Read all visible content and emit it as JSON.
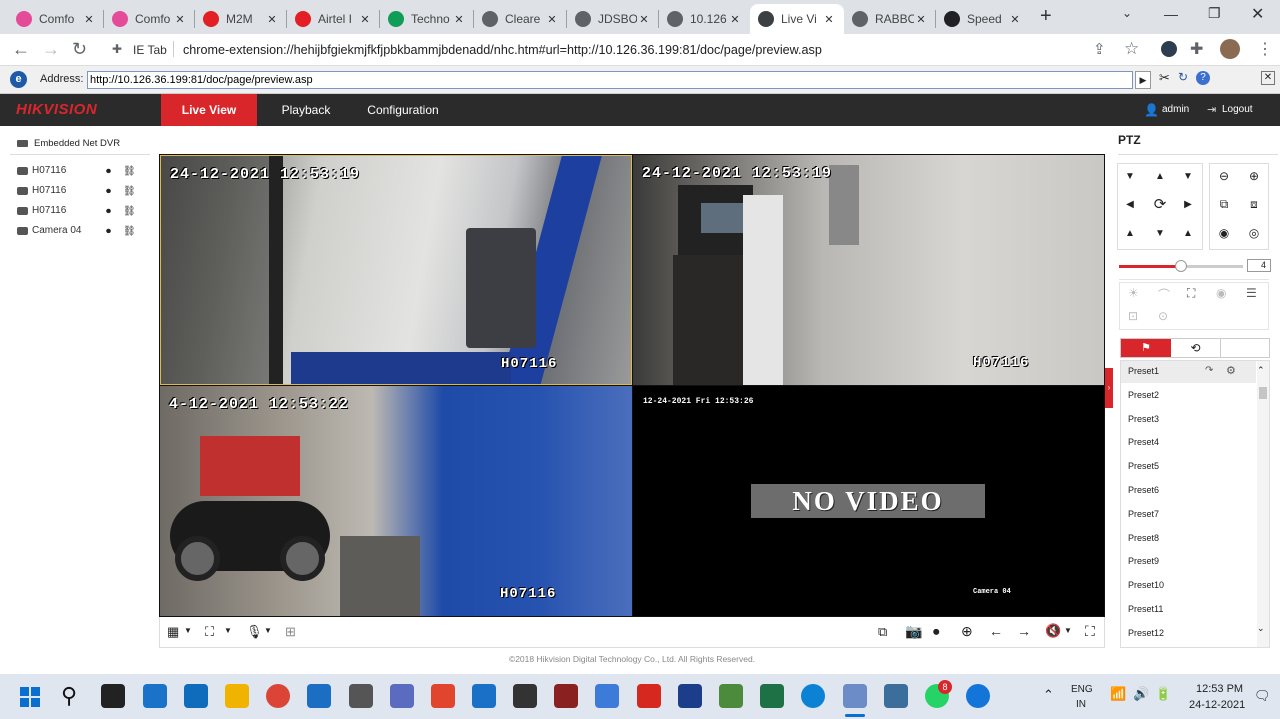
{
  "tabs": [
    {
      "title": "Comfo",
      "color": "#e44c9a"
    },
    {
      "title": "Comfo",
      "color": "#e44c9a"
    },
    {
      "title": "M2M",
      "color": "#e31e24"
    },
    {
      "title": "Airtel I",
      "color": "#e31e24"
    },
    {
      "title": "Techno",
      "color": "#0f9d58"
    },
    {
      "title": "Cleare",
      "color": "#5f6368"
    },
    {
      "title": "JDSBO",
      "color": "#5f6368"
    },
    {
      "title": "10.126",
      "color": "#5f6368"
    },
    {
      "title": "Live Vi",
      "color": "#3c4043",
      "active": true
    },
    {
      "title": "RABBO",
      "color": "#5f6368"
    },
    {
      "title": "Speed",
      "color": "#202124"
    }
  ],
  "toolbar": {
    "ext_label": "IE Tab",
    "url": "chrome-extension://hehijbfgiekmjfkfjpbkbammjbdenadd/nhc.htm#url=http://10.126.36.199:81/doc/page/preview.asp"
  },
  "ietab": {
    "address_label": "Address:",
    "address_value": "http://10.126.36.199:81/doc/page/preview.asp"
  },
  "hik": {
    "logo": "HIKVISION",
    "nav": [
      "Live View",
      "Playback",
      "Configuration"
    ],
    "user": "admin",
    "logout": "Logout"
  },
  "left_panel": {
    "device": "Embedded Net DVR",
    "cameras": [
      "H07116",
      "H07116",
      "H07116",
      "Camera 04"
    ]
  },
  "videos": [
    {
      "timestamp": "24-12-2021 12:53:19",
      "label": "H07116"
    },
    {
      "timestamp": "24-12-2021 12:53:19",
      "label": "H07116"
    },
    {
      "timestamp": "4-12-2021 12:53:22",
      "label": "H07116"
    },
    {
      "timestamp": "12-24-2021 Fri 12:53:26",
      "label": "Camera 04",
      "no_video": "NO VIDEO"
    }
  ],
  "ptz": {
    "title": "PTZ",
    "speed": "4",
    "presets": [
      "Preset1",
      "Preset2",
      "Preset3",
      "Preset4",
      "Preset5",
      "Preset6",
      "Preset7",
      "Preset8",
      "Preset9",
      "Preset10",
      "Preset11",
      "Preset12"
    ]
  },
  "footer": "©2018 Hikvision Digital Technology Co., Ltd. All Rights Reserved.",
  "tray": {
    "lang1": "ENG",
    "lang2": "IN",
    "time": "12:53 PM",
    "date": "24-12-2021",
    "whatsapp_badge": "8"
  }
}
